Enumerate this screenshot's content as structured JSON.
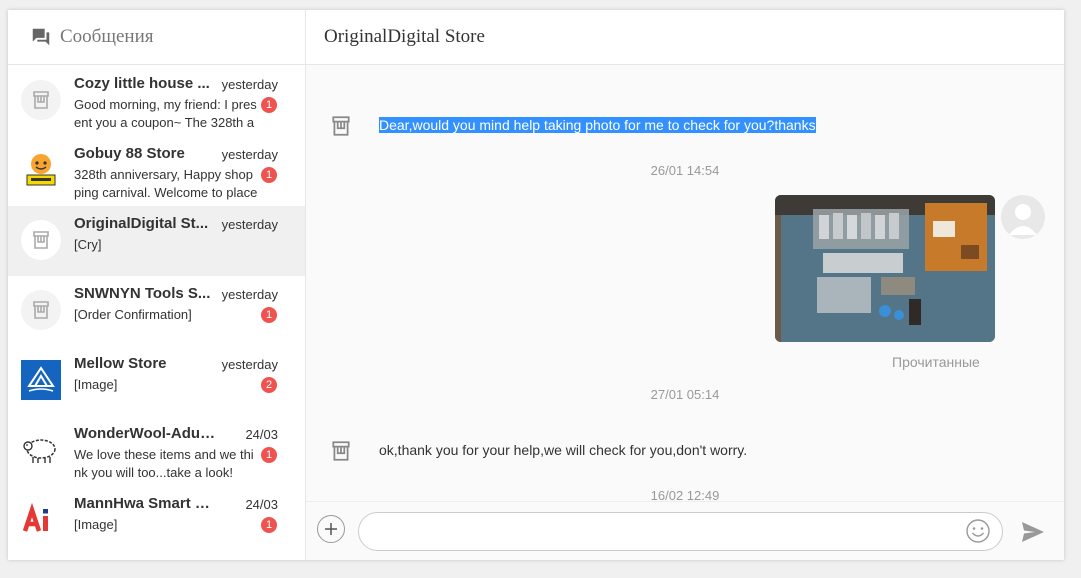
{
  "sidebar": {
    "title": "Сообщения",
    "conversations": [
      {
        "name": "Cozy little house ...",
        "time": "yesterday",
        "preview": "Good morning, my friend: I present you a coupon~ The 328th a",
        "badge": "1",
        "avatar": "store-icon"
      },
      {
        "name": "Gobuy 88 Store",
        "time": "yesterday",
        "preview": "328th anniversary, Happy shopping carnival. Welcome to place",
        "badge": "1",
        "avatar": "welcome-mascot"
      },
      {
        "name": "OriginalDigital St...",
        "time": "yesterday",
        "preview": "[Cry]",
        "badge": "",
        "avatar": "store-icon"
      },
      {
        "name": "SNWNYN Tools S...",
        "time": "yesterday",
        "preview": "[Order Confirmation]",
        "badge": "1",
        "avatar": "store-icon"
      },
      {
        "name": "Mellow Store",
        "time": "yesterday",
        "preview": "[Image]",
        "badge": "2",
        "avatar": "mellow-logo"
      },
      {
        "name": "WonderWool-Adult ...",
        "time": "24/03",
        "preview": "We love these items and we think you will too...take a look!",
        "badge": "1",
        "avatar": "sheep-logo"
      },
      {
        "name": "MannHwa Smart Ho...",
        "time": "24/03",
        "preview": "[Image]",
        "badge": "1",
        "avatar": "ai-logo"
      }
    ]
  },
  "chat": {
    "title": "OriginalDigital Store",
    "messages": {
      "first": "Dear,would you mind help taking photo for me to check for you?thanks",
      "ts1": "26/01 14:54",
      "read_status": "Прочитанные",
      "ts2": "27/01 05:14",
      "second": "ok,thank you for your help,we will check for you,don't worry.",
      "ts3": "16/02 12:49"
    },
    "input": {
      "placeholder": ""
    }
  },
  "colors": {
    "badge": "#ef5350",
    "selection": "#3390ff",
    "active_row": "#f0f0f0"
  }
}
